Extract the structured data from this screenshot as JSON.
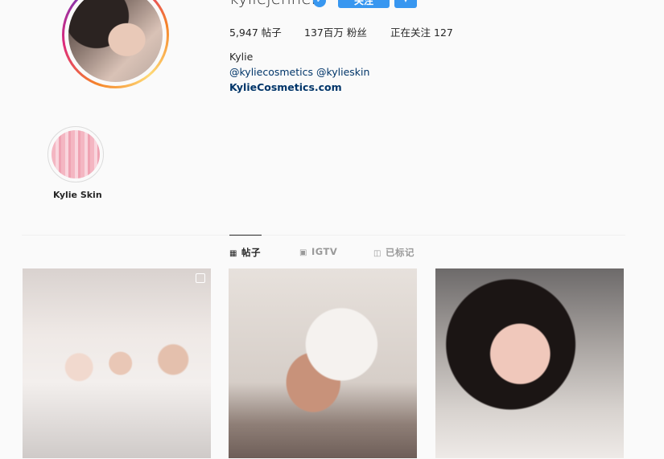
{
  "profile": {
    "username": "kyliejenner",
    "follow_label": "关注",
    "more_label": "▾",
    "stats": {
      "posts_count": "5,947",
      "posts_label": "帖子",
      "followers_count": "137百万",
      "followers_label": "粉丝",
      "following_label": "正在关注",
      "following_count": "127"
    },
    "bio": {
      "name": "Kylie",
      "mentions": "@kyliecosmetics @kylieskin",
      "link": "KylieCosmetics.com"
    }
  },
  "highlights": [
    {
      "label": "Kylie Skin"
    }
  ],
  "tabs": [
    {
      "label": "帖子",
      "icon": "grid-icon"
    },
    {
      "label": "IGTV",
      "icon": "igtv-icon"
    },
    {
      "label": "已标记",
      "icon": "tagged-icon"
    }
  ],
  "colors": {
    "accent": "#3897f0",
    "link": "#003569",
    "text": "#262626",
    "muted": "#999999",
    "background": "#fafafa"
  }
}
